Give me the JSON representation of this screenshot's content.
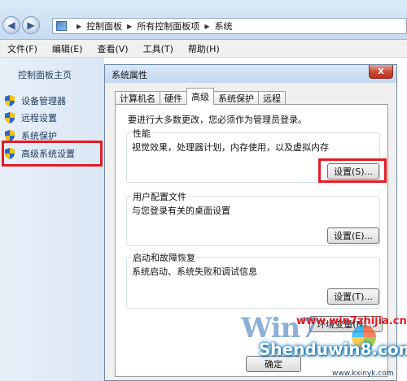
{
  "address": {
    "crumbs": [
      "控制面板",
      "所有控制面板项",
      "系统"
    ]
  },
  "menubar": {
    "items": [
      "文件(F)",
      "编辑(E)",
      "查看(V)",
      "工具(T)",
      "帮助(H)"
    ]
  },
  "leftpane": {
    "home": "控制面板主页",
    "items": [
      "设备管理器",
      "远程设置",
      "系统保护",
      "高级系统设置"
    ]
  },
  "dialog": {
    "title": "系统属性",
    "close": "X",
    "tabs": [
      "计算机名",
      "硬件",
      "高级",
      "系统保护",
      "远程"
    ],
    "active_tab": "高级",
    "admin_note": "要进行大多数更改，您必须作为管理员登录。",
    "performance": {
      "title": "性能",
      "desc": "视觉效果，处理器计划，内存使用，以及虚拟内存",
      "button": "设置(S)..."
    },
    "user_profiles": {
      "title": "用户配置文件",
      "desc": "与您登录有关的桌面设置",
      "button": "设置(E)..."
    },
    "startup": {
      "title": "启动和故障恢复",
      "desc": "系统启动、系统失败和调试信息",
      "button": "设置(T)..."
    },
    "env_button": "环境变量(N)...",
    "ok_button": "确定"
  },
  "watermark": {
    "logo": "Win7",
    "site1": "www.win7zhijia.cn",
    "site2": "Shenduwin8.com",
    "site3": "www.kxinyk.com"
  },
  "colors": {
    "highlight": "#e31b23",
    "link": "#1e395b"
  }
}
